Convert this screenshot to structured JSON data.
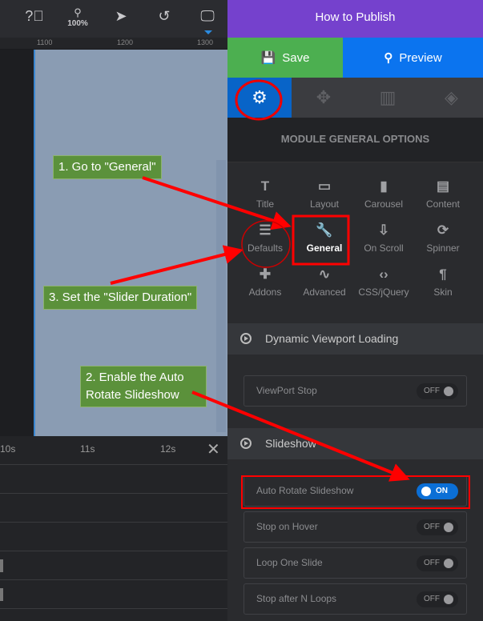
{
  "toolbar": {
    "zoom": "100%",
    "icons": [
      "help-icon",
      "zoom-icon",
      "cursor-icon",
      "undo-icon",
      "desktop-icon"
    ]
  },
  "ruler": [
    "1100",
    "1200",
    "1300"
  ],
  "timeline": {
    "marks": [
      "10s",
      "11s",
      "12s"
    ],
    "close": "✕"
  },
  "panel": {
    "title": "How to Publish",
    "save": "Save",
    "preview": "Preview",
    "tabs": [
      "settings",
      "navigation",
      "slides",
      "layers"
    ],
    "heading": "MODULE GENERAL OPTIONS",
    "options": [
      {
        "label": "Title",
        "icon": "T"
      },
      {
        "label": "Layout",
        "icon": "▭"
      },
      {
        "label": "Carousel",
        "icon": "▮"
      },
      {
        "label": "Content",
        "icon": "▤"
      },
      {
        "label": "Defaults",
        "icon": "☰"
      },
      {
        "label": "General",
        "icon": "🔧",
        "active": true
      },
      {
        "label": "On Scroll",
        "icon": "⇩"
      },
      {
        "label": "Spinner",
        "icon": "⟳"
      },
      {
        "label": "Addons",
        "icon": "✚"
      },
      {
        "label": "Advanced",
        "icon": "∿"
      },
      {
        "label": "CSS/jQuery",
        "icon": "‹›"
      },
      {
        "label": "Skin",
        "icon": "¶"
      }
    ],
    "sections": [
      {
        "title": "Dynamic Viewport Loading",
        "rows": [
          {
            "label": "ViewPort Stop",
            "state": "OFF"
          }
        ]
      },
      {
        "title": "Slideshow",
        "rows": [
          {
            "label": "Auto Rotate Slideshow",
            "state": "ON"
          },
          {
            "label": "Stop on Hover",
            "state": "OFF"
          },
          {
            "label": "Loop One Slide",
            "state": "OFF"
          },
          {
            "label": "Stop after N Loops",
            "state": "OFF"
          }
        ]
      }
    ]
  },
  "annotations": {
    "step1": "1. Go to \"General\"",
    "step2": "2. Enable the Auto Rotate Slideshow",
    "step3": "3. Set the \"Slider Duration\""
  },
  "colors": {
    "title": "#7541cd",
    "save": "#4caf50",
    "preview": "#0b74ef",
    "accent": "#0b6fd6",
    "annotation": "#ff0000",
    "note": "#5b913b"
  }
}
